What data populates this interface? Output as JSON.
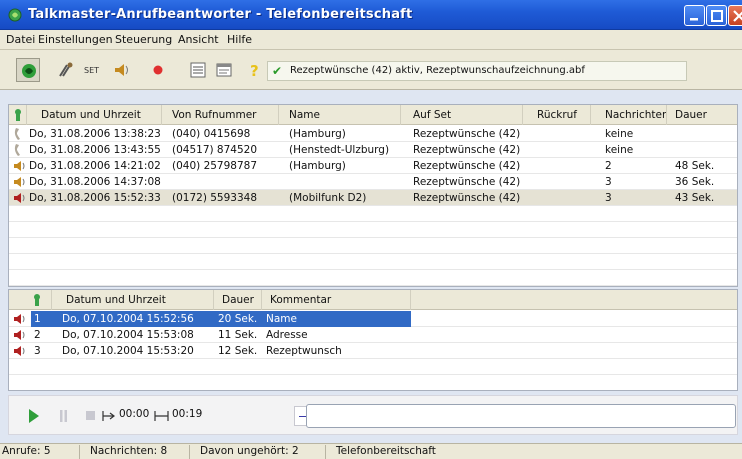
{
  "window": {
    "title": "Talkmaster-Anrufbeantworter - Telefonbereitschaft"
  },
  "menu": [
    "Datei",
    "Einstellungen",
    "Steuerung",
    "Ansicht",
    "Hilfe"
  ],
  "toolbar": {
    "status_text": "Rezeptwünsche (42) aktiv, Rezeptwunschaufzeichnung.abf",
    "set_label": "SET",
    "help_glyph": "?"
  },
  "calls": {
    "columns": [
      "Datum und Uhrzeit",
      "Von Rufnummer",
      "Name",
      "Auf Set",
      "Rückruf",
      "Nachrichten",
      "Dauer"
    ],
    "rows": [
      {
        "icon": "phone-icon",
        "datetime": "Do, 31.08.2006 13:38:23",
        "number": "(040) 0415698",
        "name": "(Hamburg)",
        "set": "Rezeptwünsche (42)",
        "callback": "",
        "messages": "keine",
        "duration": ""
      },
      {
        "icon": "phone-icon",
        "datetime": "Do, 31.08.2006 13:43:55",
        "number": "(04517) 874520",
        "name": "(Henstedt-Ulzburg)",
        "set": "Rezeptwünsche (42)",
        "callback": "",
        "messages": "keine",
        "duration": ""
      },
      {
        "icon": "speaker-icon",
        "datetime": "Do, 31.08.2006 14:21:02",
        "number": "(040) 25798787",
        "name": "(Hamburg)",
        "set": "Rezeptwünsche (42)",
        "callback": "",
        "messages": "2",
        "duration": "48 Sek."
      },
      {
        "icon": "speaker-icon",
        "datetime": "Do, 31.08.2006 14:37:08",
        "number": "",
        "name": "",
        "set": "Rezeptwünsche (42)",
        "callback": "",
        "messages": "3",
        "duration": "36 Sek."
      },
      {
        "icon": "speaker-red-icon",
        "datetime": "Do, 31.08.2006 15:52:33",
        "number": "(0172) 5593348",
        "name": "(Mobilfunk D2)",
        "set": "Rezeptwünsche (42)",
        "callback": "",
        "messages": "3",
        "duration": "43 Sek."
      }
    ],
    "selected_row": 4
  },
  "messages": {
    "columns": [
      "Datum und Uhrzeit",
      "Dauer",
      "Kommentar"
    ],
    "rows": [
      {
        "index": "1",
        "datetime": "Do, 07.10.2004 15:52:56",
        "duration": "20 Sek.",
        "comment": "Name"
      },
      {
        "index": "2",
        "datetime": "Do, 07.10.2004 15:53:08",
        "duration": "11 Sek.",
        "comment": "Adresse"
      },
      {
        "index": "3",
        "datetime": "Do, 07.10.2004 15:53:20",
        "duration": "12 Sek.",
        "comment": "Rezeptwunsch"
      }
    ],
    "selected_row": 0
  },
  "player": {
    "position": "00:00",
    "length": "00:19"
  },
  "statusbar": {
    "calls": "Anrufe: 5",
    "messages": "Nachrichten: 8",
    "unheard": "Davon ungehört: 2",
    "profile": "Telefonbereitschaft"
  },
  "colors": {
    "title_bar": "#1f5bd6",
    "selection": "#316ac5",
    "check": "#2a9a2a",
    "record": "#e03030"
  }
}
